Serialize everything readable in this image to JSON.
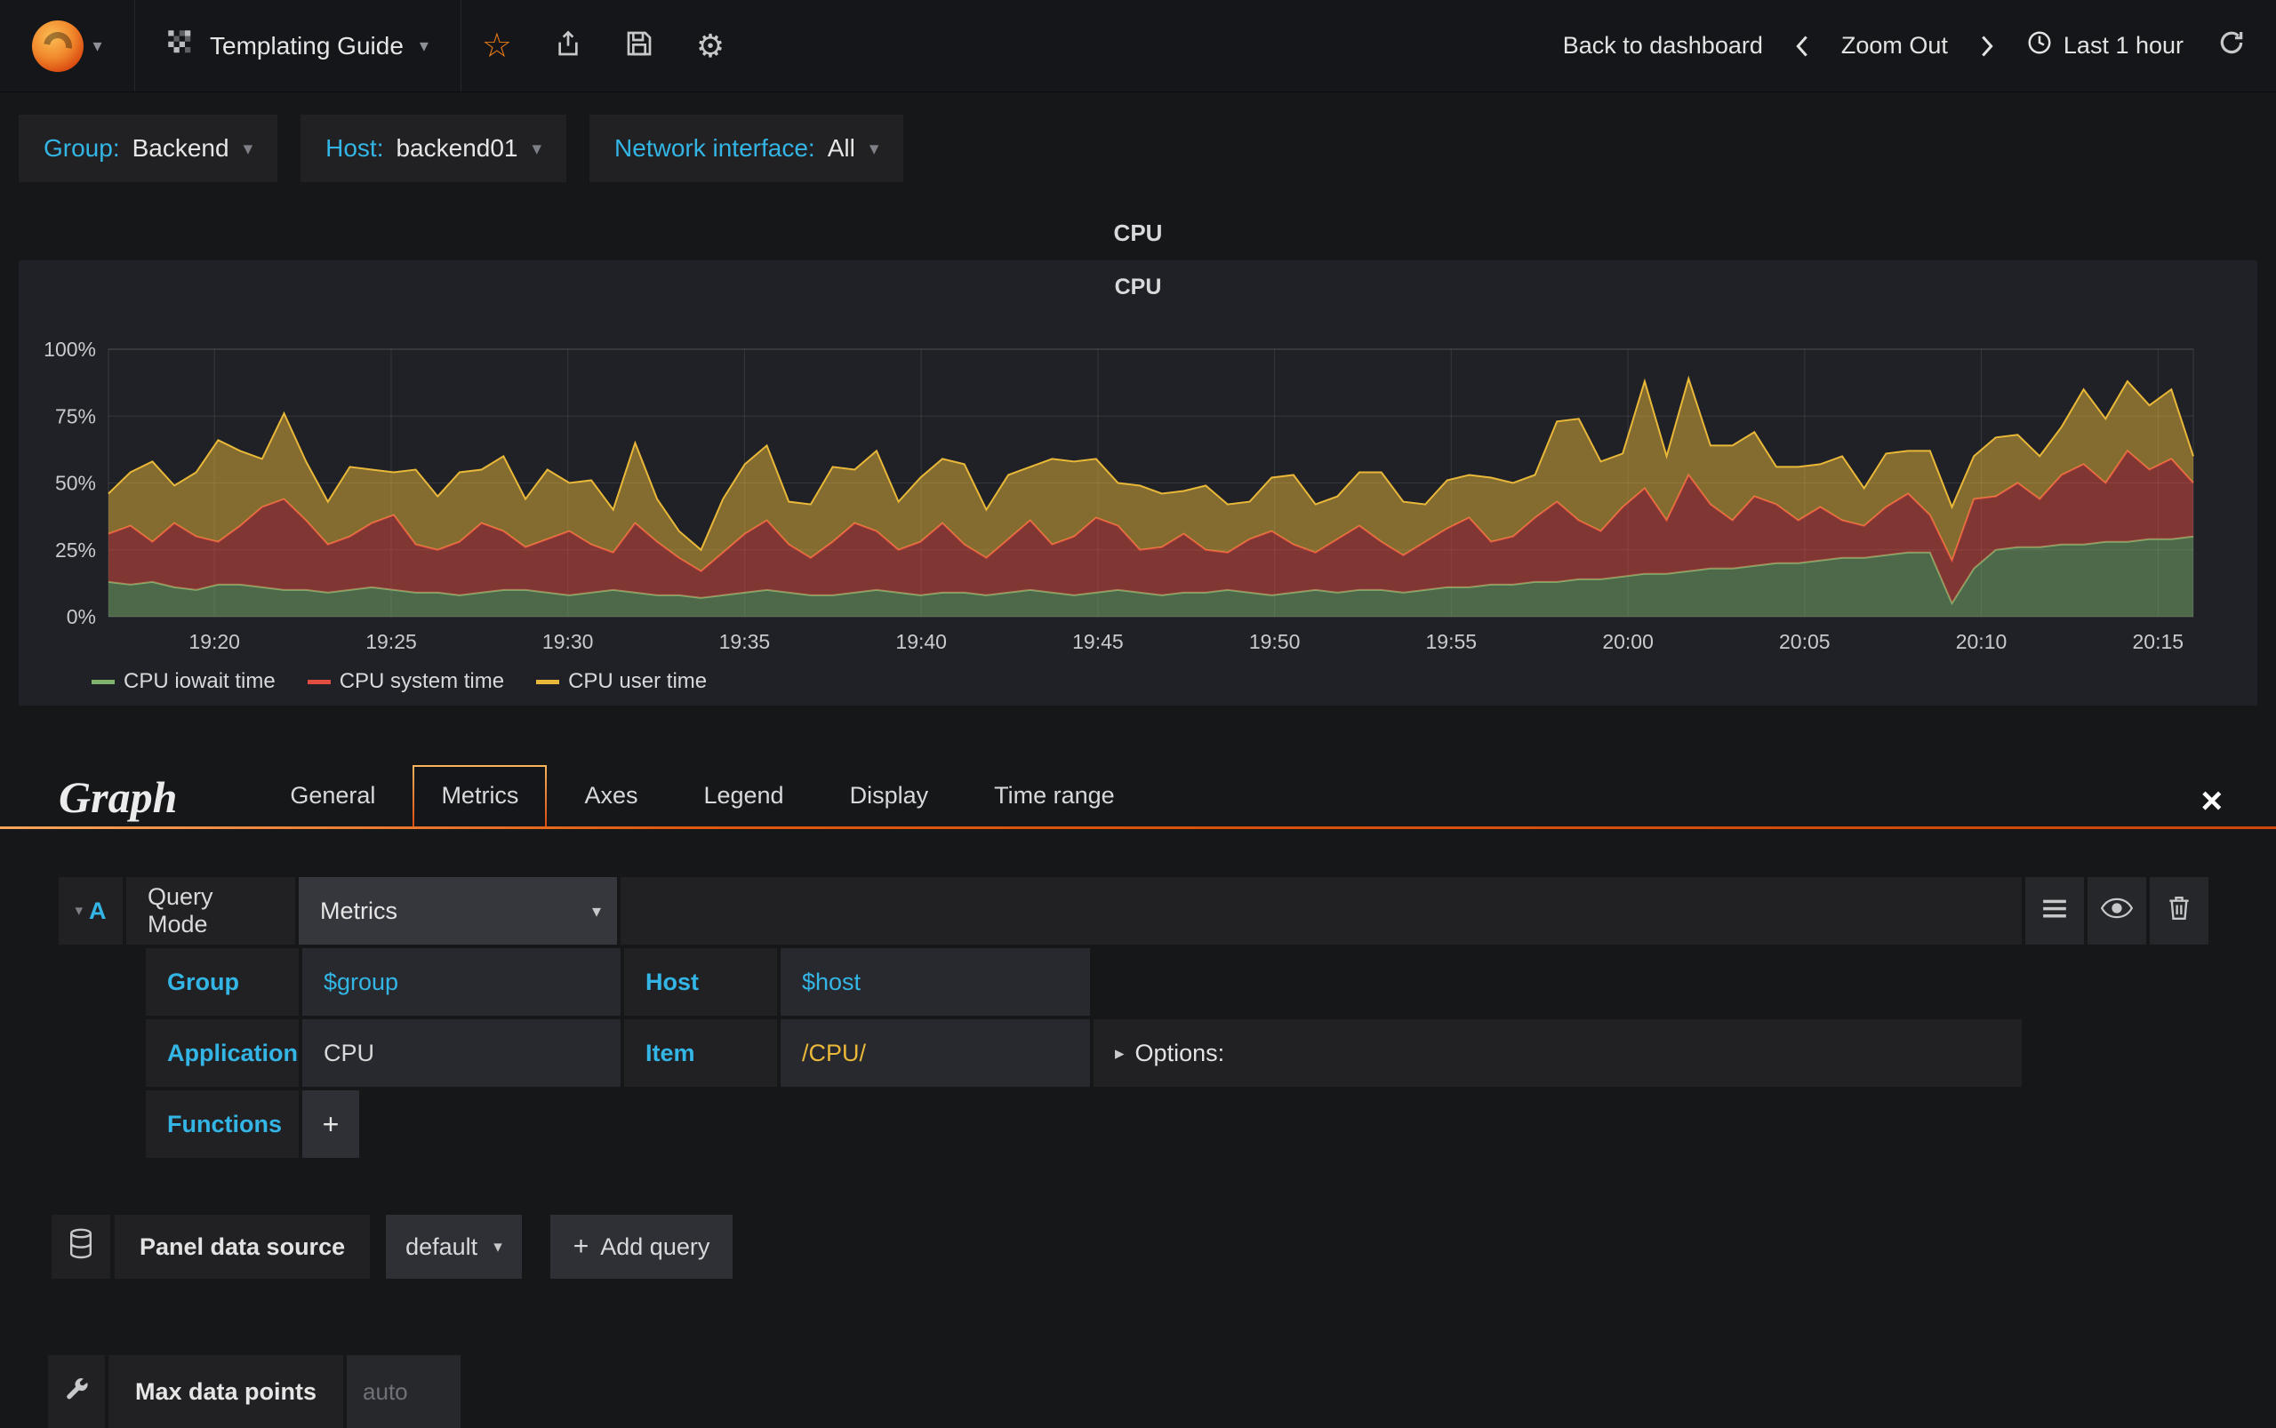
{
  "glyphs": {
    "caret_down": "▾",
    "caret_right": "▸",
    "plus": "+",
    "close": "×",
    "star": "☆",
    "gear": "⚙"
  },
  "navbar": {
    "title": "Templating Guide",
    "back_to_dashboard": "Back to dashboard",
    "zoom_out": "Zoom Out",
    "time_range": "Last 1 hour"
  },
  "variables": [
    {
      "label": "Group:",
      "value": "Backend"
    },
    {
      "label": "Host:",
      "value": "backend01"
    },
    {
      "label": "Network interface:",
      "value": "All"
    }
  ],
  "panel": {
    "outer_title": "CPU",
    "title": "CPU"
  },
  "chart_data": {
    "type": "area",
    "stacked": true,
    "title": "CPU",
    "ylabel": "",
    "xlabel": "",
    "ylim": [
      0,
      100
    ],
    "xlim_minutes": [
      1157,
      1216
    ],
    "grid": true,
    "legend_position": "bottom-left",
    "y_ticks": [
      {
        "value": 0,
        "label": "0%"
      },
      {
        "value": 25,
        "label": "25%"
      },
      {
        "value": 50,
        "label": "50%"
      },
      {
        "value": 75,
        "label": "75%"
      },
      {
        "value": 100,
        "label": "100%"
      }
    ],
    "x_ticks": [
      {
        "minutes": 1160,
        "label": "19:20"
      },
      {
        "minutes": 1165,
        "label": "19:25"
      },
      {
        "minutes": 1170,
        "label": "19:30"
      },
      {
        "minutes": 1175,
        "label": "19:35"
      },
      {
        "minutes": 1180,
        "label": "19:40"
      },
      {
        "minutes": 1185,
        "label": "19:45"
      },
      {
        "minutes": 1190,
        "label": "19:50"
      },
      {
        "minutes": 1195,
        "label": "19:55"
      },
      {
        "minutes": 1200,
        "label": "20:00"
      },
      {
        "minutes": 1205,
        "label": "20:05"
      },
      {
        "minutes": 1210,
        "label": "20:10"
      },
      {
        "minutes": 1215,
        "label": "20:15"
      }
    ],
    "series": [
      {
        "name": "CPU iowait time",
        "color": "#7EB26D",
        "values": [
          13,
          12,
          13,
          11,
          10,
          12,
          12,
          11,
          10,
          10,
          9,
          10,
          11,
          10,
          9,
          9,
          8,
          9,
          10,
          10,
          9,
          8,
          9,
          10,
          9,
          8,
          8,
          7,
          8,
          9,
          10,
          9,
          8,
          8,
          9,
          10,
          9,
          8,
          9,
          9,
          8,
          9,
          10,
          9,
          8,
          9,
          10,
          9,
          8,
          9,
          9,
          10,
          9,
          8,
          9,
          10,
          9,
          10,
          10,
          9,
          10,
          11,
          11,
          12,
          12,
          13,
          13,
          14,
          14,
          15,
          16,
          16,
          17,
          18,
          18,
          19,
          20,
          20,
          21,
          22,
          22,
          23,
          24,
          24,
          5,
          18,
          25,
          26,
          26,
          27,
          27,
          28,
          28,
          29,
          29,
          30
        ]
      },
      {
        "name": "CPU system time",
        "color": "#E24D42",
        "values": [
          18,
          22,
          15,
          24,
          20,
          16,
          22,
          30,
          34,
          26,
          18,
          20,
          24,
          28,
          18,
          16,
          20,
          26,
          22,
          16,
          20,
          24,
          18,
          14,
          26,
          20,
          14,
          10,
          16,
          22,
          26,
          18,
          14,
          20,
          26,
          22,
          16,
          20,
          26,
          18,
          14,
          20,
          26,
          18,
          22,
          28,
          24,
          16,
          18,
          22,
          16,
          14,
          20,
          24,
          18,
          14,
          20,
          24,
          18,
          14,
          18,
          22,
          26,
          16,
          18,
          24,
          30,
          22,
          18,
          26,
          32,
          20,
          36,
          24,
          18,
          26,
          22,
          16,
          20,
          14,
          12,
          18,
          22,
          14,
          16,
          26,
          20,
          24,
          18,
          26,
          30,
          22,
          34,
          26,
          30,
          20
        ]
      },
      {
        "name": "CPU user time",
        "color": "#EAB839",
        "values": [
          15,
          20,
          30,
          14,
          24,
          38,
          28,
          18,
          32,
          22,
          16,
          26,
          20,
          16,
          28,
          20,
          26,
          20,
          28,
          18,
          26,
          18,
          24,
          16,
          30,
          16,
          10,
          8,
          20,
          26,
          28,
          16,
          20,
          28,
          20,
          30,
          18,
          24,
          24,
          30,
          18,
          24,
          20,
          32,
          28,
          22,
          16,
          24,
          20,
          16,
          24,
          18,
          14,
          20,
          26,
          18,
          16,
          20,
          26,
          20,
          14,
          18,
          16,
          24,
          20,
          16,
          30,
          38,
          26,
          20,
          40,
          24,
          36,
          22,
          28,
          24,
          14,
          20,
          16,
          24,
          14,
          20,
          16,
          24,
          20,
          16,
          22,
          18,
          16,
          18,
          28,
          24,
          26,
          24,
          26,
          10
        ]
      }
    ]
  },
  "editor": {
    "panel_type": "Graph",
    "tabs": [
      "General",
      "Metrics",
      "Axes",
      "Legend",
      "Display",
      "Time range"
    ],
    "active_tab": "Metrics",
    "query": {
      "letter": "A",
      "mode_label": "Query Mode",
      "mode_value": "Metrics",
      "group_label": "Group",
      "group_value": "$group",
      "host_label": "Host",
      "host_value": "$host",
      "application_label": "Application",
      "application_value": "CPU",
      "item_label": "Item",
      "item_value": "/CPU/",
      "options_label": "Options:",
      "functions_label": "Functions"
    },
    "datasource": {
      "label": "Panel data source",
      "value": "default",
      "add_query_label": "Add query"
    },
    "max_data_points": {
      "label": "Max data points",
      "placeholder": "auto"
    }
  }
}
